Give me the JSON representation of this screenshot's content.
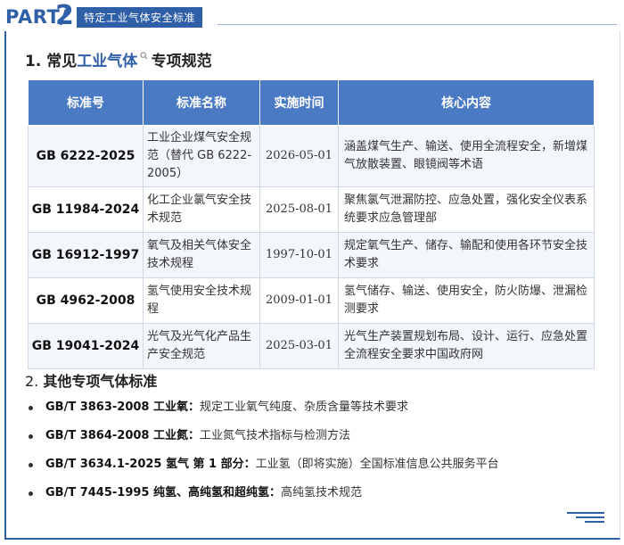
{
  "header": {
    "part_label": "PART/",
    "part_number": "2",
    "section_tag": "特定工业气体安全标准"
  },
  "section1": {
    "prefix": "1. 常见",
    "highlight": "工业气体",
    "suffix": "专项规范"
  },
  "table": {
    "columns": [
      "标准号",
      "标准名称",
      "实施时间",
      "核心内容"
    ],
    "rows": [
      {
        "code": "GB 6222-2025",
        "name": "工业企业煤气安全规范（替代 GB 6222-2005）",
        "date": "2026-05-01",
        "content": "涵盖煤气生产、输送、使用全流程安全，新增煤气放散装置、眼镜阀等术语"
      },
      {
        "code": "GB 11984-2024",
        "name": "化工企业氯气安全技术规范",
        "date": "2025-08-01",
        "content": "聚焦氯气泄漏防控、应急处置，强化安全仪表系统要求应急管理部"
      },
      {
        "code": "GB 16912-1997",
        "name": "氧气及相关气体安全技术规程",
        "date": "1997-10-01",
        "content": "规定氧气生产、储存、输配和使用各环节安全技术要求"
      },
      {
        "code": "GB 4962-2008",
        "name": "氢气使用安全技术规程",
        "date": "2009-01-01",
        "content": "氢气储存、输送、使用安全，防火防爆、泄漏检测要求"
      },
      {
        "code": "GB 19041-2024",
        "name": "光气及光气化产品生产安全规范",
        "date": "2025-03-01",
        "content": "光气生产装置规划布局、设计、运行、应急处置全流程安全要求中国政府网"
      }
    ]
  },
  "section2": {
    "prefix": "2. ",
    "title": "其他专项气体标准"
  },
  "other_items": [
    {
      "code": "GB/T 3863-2008 工业氧：",
      "desc": "规定工业氧气纯度、杂质含量等技术要求"
    },
    {
      "code": "GB/T 3864-2008 工业氮：",
      "desc": "工业氮气技术指标与检测方法"
    },
    {
      "code": "GB/T 3634.1-2025 氢气 第 1 部分：",
      "desc": "工业氢（即将实施）全国标准信息公共服务平台"
    },
    {
      "code": "GB/T 7445-1995 纯氢、高纯氢和超纯氢：",
      "desc": "高纯氢技术规范"
    }
  ],
  "colors": {
    "accent": "#2f5fa7",
    "table_header": "#4a7ac4"
  },
  "icons": {
    "search": "search-icon"
  }
}
